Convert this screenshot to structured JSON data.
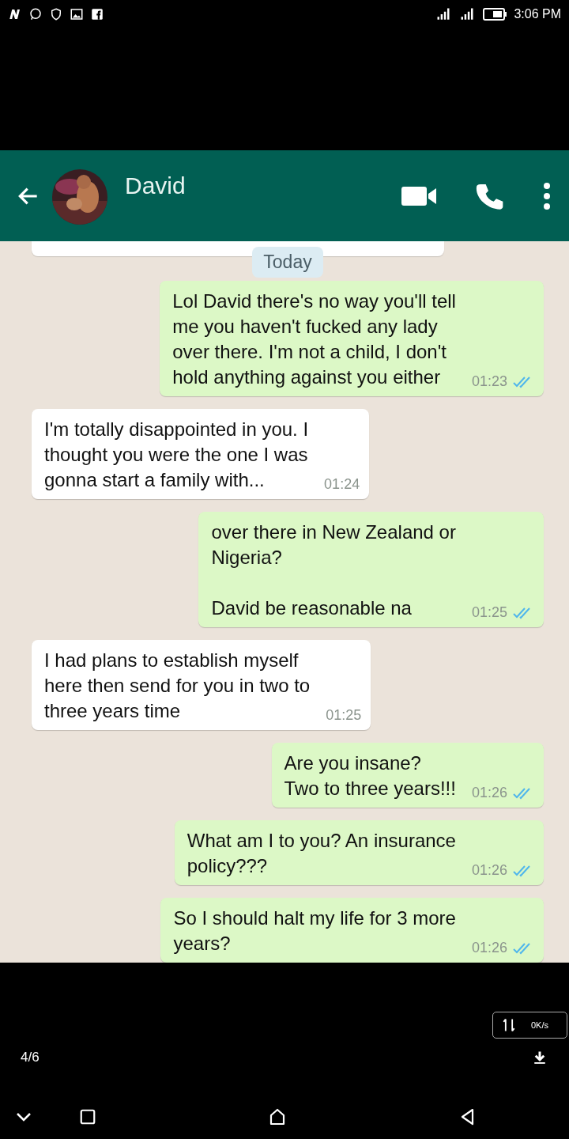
{
  "status_bar": {
    "time": "3:06 PM"
  },
  "chat": {
    "contact": "David",
    "date_label": "Today",
    "messages": [
      {
        "kind": "out",
        "text": "Lol David there's no way you'll tell\nme you haven't fucked any lady\nover there. I'm not a child, I don't\nhold anything against you either",
        "time": "01:23",
        "read": true
      },
      {
        "kind": "in",
        "text": "I'm totally disappointed in you. I\nthought you were the one I was\ngonna start a family with...",
        "time": "01:24"
      },
      {
        "kind": "out",
        "text": "over there in New Zealand or\nNigeria?\n\nDavid be reasonable na",
        "time": "01:25",
        "read": true
      },
      {
        "kind": "in",
        "text": "I had plans to establish myself\nhere then send for you in two to\nthree years time",
        "time": "01:25"
      },
      {
        "kind": "out",
        "text": "Are you insane?\nTwo to three years!!!",
        "time": "01:26",
        "read": true
      },
      {
        "kind": "out",
        "text": "What am I to you? An insurance\npolicy???",
        "time": "01:26",
        "read": true
      },
      {
        "kind": "out",
        "text": "So I should halt my life for 3 more\nyears?",
        "time": "01:26",
        "read": true
      }
    ]
  },
  "viewer": {
    "net_speed": "0K/s",
    "page_counter": "4/6"
  }
}
